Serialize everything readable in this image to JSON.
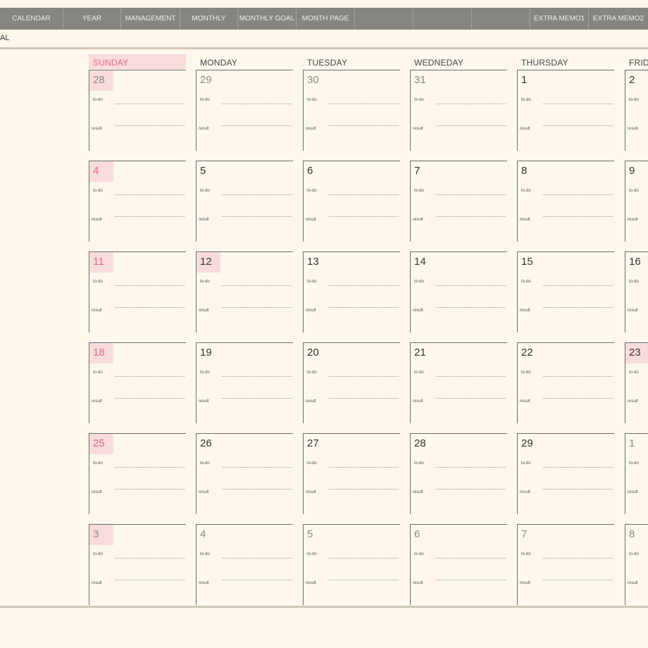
{
  "nav": {
    "tabs": [
      "CALENDAR",
      "YEAR",
      "MANAGEMENT",
      "MONTHLY",
      "MONTHLY GOAL",
      "MONTH PAGE",
      "",
      "",
      "",
      "EXTRA MEMO1",
      "EXTRA MEMO2"
    ]
  },
  "page": {
    "subtitle": "AL"
  },
  "calendar": {
    "days": [
      "SUNDAY",
      "MONDAY",
      "TUESDAY",
      "WEDNEDAY",
      "THURSDAY",
      "FRIDAY"
    ],
    "todo_label": "to-do",
    "result_label": "result",
    "weeks": [
      [
        "28",
        "29",
        "30",
        "31",
        "1",
        "2"
      ],
      [
        "4",
        "5",
        "6",
        "7",
        "8",
        "9"
      ],
      [
        "11",
        "12",
        "13",
        "14",
        "15",
        "16"
      ],
      [
        "18",
        "19",
        "20",
        "21",
        "22",
        "23"
      ],
      [
        "25",
        "26",
        "27",
        "28",
        "29",
        "1"
      ],
      [
        "3",
        "4",
        "5",
        "6",
        "7",
        "8"
      ]
    ]
  },
  "colors": {
    "accent_pink": "#e56a82",
    "highlight": "#f8dcdc",
    "tab_bar": "#898883",
    "background": "#fdf7ec"
  }
}
